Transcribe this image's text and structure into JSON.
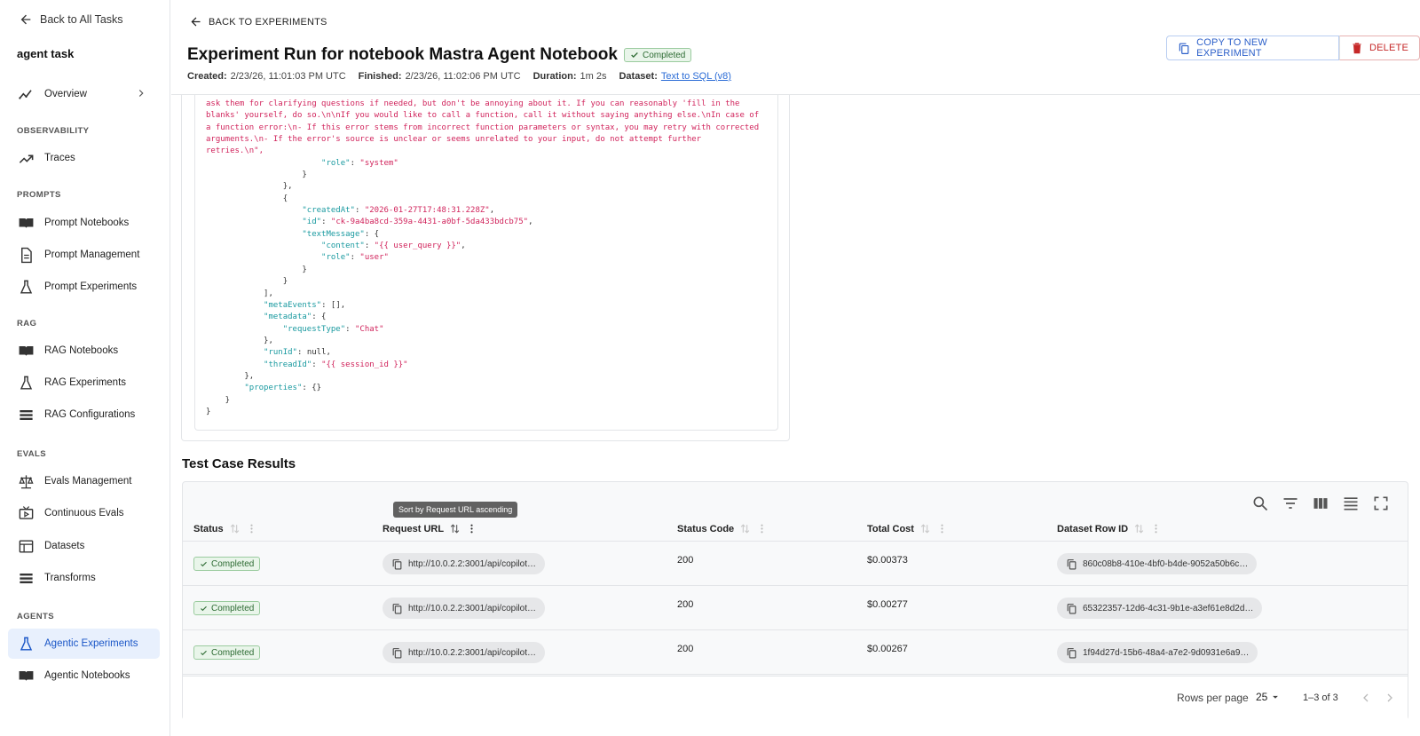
{
  "sidebar": {
    "back_label": "Back to All Tasks",
    "task_name": "agent task",
    "overview": "Overview",
    "sections": {
      "observability": "OBSERVABILITY",
      "prompts": "PROMPTS",
      "rag": "RAG",
      "evals": "EVALS",
      "agents": "AGENTS"
    },
    "items": {
      "traces": "Traces",
      "prompt_notebooks": "Prompt Notebooks",
      "prompt_management": "Prompt Management",
      "prompt_experiments": "Prompt Experiments",
      "rag_notebooks": "RAG Notebooks",
      "rag_experiments": "RAG Experiments",
      "rag_configurations": "RAG Configurations",
      "evals_management": "Evals Management",
      "continuous_evals": "Continuous Evals",
      "datasets": "Datasets",
      "transforms": "Transforms",
      "agentic_experiments": "Agentic Experiments",
      "agentic_notebooks": "Agentic Notebooks"
    },
    "active_item": "Agentic Experiments"
  },
  "header": {
    "back_label": "BACK TO EXPERIMENTS",
    "title": "Experiment Run for notebook Mastra Agent Notebook",
    "status": "Completed",
    "created_label": "Created:",
    "created": "2/23/26, 11:01:03 PM UTC",
    "finished_label": "Finished:",
    "finished": "2/23/26, 11:02:06 PM UTC",
    "duration_label": "Duration:",
    "duration": "1m 2s",
    "dataset_label": "Dataset:",
    "dataset": "Text to SQL (v8)",
    "copy_button": "COPY TO NEW EXPERIMENT",
    "delete_button": "DELETE"
  },
  "code": {
    "prompt_text_lines": [
      "ask them for clarifying questions if needed, but don't be annoying about it. If you can reasonably 'fill in the",
      "blanks' yourself, do so.\\n\\nIf you would like to call a function, call it without saying anything else.\\nIn case of",
      "a function error:\\n- If this error stems from incorrect function parameters or syntax, you may retry with corrected",
      "arguments.\\n- If the error's source is unclear or seems unrelated to your input, do not attempt further",
      "retries.\\n\","
    ],
    "role_system": "\"system\"",
    "created_at": "\"2026-01-27T17:48:31.228Z\"",
    "id": "\"ck-9a4ba8cd-359a-4431-a0bf-5da433bdcb75\"",
    "content": "\"{{ user_query }}\"",
    "role_user": "\"user\"",
    "meta_events": "[]",
    "request_type": "\"Chat\"",
    "run_id": "null",
    "thread_id": "\"{{ session_id }}\"",
    "properties": "{}"
  },
  "results": {
    "title": "Test Case Results",
    "tooltip": "Sort by Request URL ascending",
    "columns": {
      "status": "Status",
      "request_url": "Request URL",
      "status_code": "Status Code",
      "total_cost": "Total Cost",
      "dataset_row_id": "Dataset Row ID"
    },
    "rows": [
      {
        "status": "Completed",
        "request_url": "http://10.0.2.2:3001/api/copilot…",
        "status_code": "200",
        "total_cost": "$0.00373",
        "dataset_row_id": "860c08b8-410e-4bf0-b4de-9052a50b6c…"
      },
      {
        "status": "Completed",
        "request_url": "http://10.0.2.2:3001/api/copilot…",
        "status_code": "200",
        "total_cost": "$0.00277",
        "dataset_row_id": "65322357-12d6-4c31-9b1e-a3ef61e8d2d…"
      },
      {
        "status": "Completed",
        "request_url": "http://10.0.2.2:3001/api/copilot…",
        "status_code": "200",
        "total_cost": "$0.00267",
        "dataset_row_id": "1f94d27d-15b6-48a4-a7e2-9d0931e6a9…"
      }
    ],
    "rows_per_page_label": "Rows per page",
    "rows_per_page": "25",
    "range": "1–3 of 3"
  },
  "colors": {
    "accent": "#1a56c7",
    "success": "#2d6b33",
    "danger": "#c62828",
    "code_key": "#1a9aa0",
    "code_string": "#d1245c"
  }
}
